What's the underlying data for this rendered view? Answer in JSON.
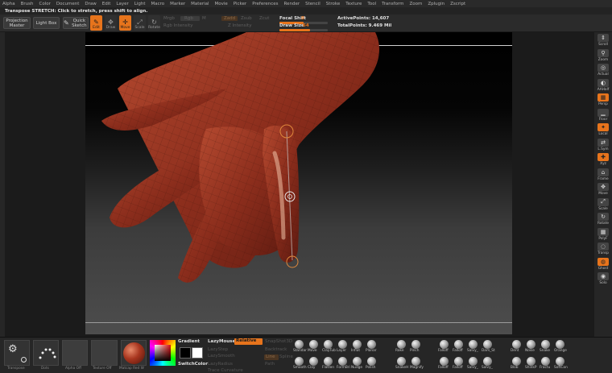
{
  "menu": [
    "Alpha",
    "Brush",
    "Color",
    "Document",
    "Draw",
    "Edit",
    "Layer",
    "Light",
    "Macro",
    "Marker",
    "Material",
    "Movie",
    "Picker",
    "Preferences",
    "Render",
    "Stencil",
    "Stroke",
    "Texture",
    "Tool",
    "Transform",
    "Zoom",
    "Zplugin",
    "Zscript"
  ],
  "hint": "Transpose STRETCH: Click to stretch, press shift to align.",
  "toolbar": {
    "projection_master": "Projection Master",
    "light_box": "Light Box",
    "quick_sketch": "Quick Sketch",
    "tools": [
      {
        "label": "Edit",
        "glyph": "✎",
        "active": true
      },
      {
        "label": "Draw",
        "glyph": "✥",
        "active": false
      },
      {
        "label": "Move",
        "glyph": "✛",
        "active": true
      },
      {
        "label": "Scale",
        "glyph": "⤢",
        "active": false
      },
      {
        "label": "Rotate",
        "glyph": "↻",
        "active": false
      }
    ],
    "mrgb": "Mrgb",
    "rgb": "Rgb",
    "m": "M",
    "rgb_intensity": "Rgb Intensity",
    "zadd": "Zadd",
    "zsub": "Zsub",
    "zcut": "Zcut",
    "z_intensity": "Z Intensity",
    "focal_shift_label": "Focal Shift",
    "focal_shift_value": "0",
    "draw_size_label": "Draw Size",
    "draw_size_value": "64",
    "active_points": "ActivePoints: 14,607",
    "total_points": "TotalPoints: 9.469 Mil"
  },
  "right_shelf": [
    {
      "label": "Scroll",
      "glyph": "⇕",
      "orange": false
    },
    {
      "label": "Zoom",
      "glyph": "⚲",
      "orange": false
    },
    {
      "label": "Actual",
      "glyph": "◎",
      "orange": false
    },
    {
      "label": "AAHalf",
      "glyph": "◐",
      "orange": false
    },
    {
      "label": "Persp",
      "glyph": "▦",
      "orange": true
    },
    {
      "label": "Floor",
      "glyph": "▁",
      "orange": false
    },
    {
      "label": "Local",
      "glyph": "✦",
      "orange": true
    },
    {
      "label": "L.Sym",
      "glyph": "⇄",
      "orange": false
    },
    {
      "label": "Xyz",
      "glyph": "✚",
      "orange": true
    },
    {
      "label": "Frame",
      "glyph": "⌂",
      "orange": false
    },
    {
      "label": "Move",
      "glyph": "✥",
      "orange": false
    },
    {
      "label": "Scale",
      "glyph": "⤢",
      "orange": false
    },
    {
      "label": "Rotate",
      "glyph": "↻",
      "orange": false
    },
    {
      "label": "PolyF",
      "glyph": "▦",
      "orange": false
    },
    {
      "label": "Transp",
      "glyph": "◌",
      "orange": false
    },
    {
      "label": "Ghost",
      "glyph": "◍",
      "orange": true
    },
    {
      "label": "Solo",
      "glyph": "◉",
      "orange": false
    }
  ],
  "bottom": {
    "swatches": [
      "Transpose",
      "Dots",
      "Alpha Off",
      "Texture Off",
      "Matcap Red W"
    ],
    "gradient": "Gradient",
    "switch_color": "SwitchColor",
    "lazymouse": "LazyMouse",
    "lazystep": "LazyStep",
    "lazysmooth": "LazySmooth",
    "lazyradius": "LazyRadius",
    "relative": "Relative",
    "backtrack": "Backtrack",
    "snapshot3d": "SnapShot3D",
    "line": "Line",
    "path": "Path",
    "spline": "Spline",
    "trace_curvature": "Trace Curvature",
    "brushes": [
      {
        "label": "Standar"
      },
      {
        "label": "Move"
      },
      {
        "label": "ClayTub"
      },
      {
        "label": "Layer"
      },
      {
        "label": "Inflat"
      },
      {
        "label": "Planar"
      },
      {
        "label": "Smooth"
      },
      {
        "label": "Clay"
      },
      {
        "label": "Flatten"
      },
      {
        "label": "FormBri"
      },
      {
        "label": "Nudge"
      },
      {
        "label": "Polish"
      },
      {
        "label": "Rake"
      },
      {
        "label": "Pinch"
      },
      {
        "label": "SnakeH"
      },
      {
        "label": "Magnify"
      },
      {
        "label": "Falloff"
      },
      {
        "label": "Falloff"
      },
      {
        "label": "Salvy_"
      },
      {
        "label": "Dam_St"
      },
      {
        "label": "Falloff"
      },
      {
        "label": "Falloff"
      },
      {
        "label": "Salvy_"
      },
      {
        "label": "Salvy_"
      },
      {
        "label": "Dent"
      },
      {
        "label": "Noise"
      },
      {
        "label": "Snake"
      },
      {
        "label": "Orange"
      },
      {
        "label": "Blob"
      },
      {
        "label": "ShinkP"
      },
      {
        "label": "Fractu"
      },
      {
        "label": "SoftCon"
      }
    ]
  },
  "colors": {
    "accent": "#e7741c",
    "model": "#8a2f1f"
  }
}
